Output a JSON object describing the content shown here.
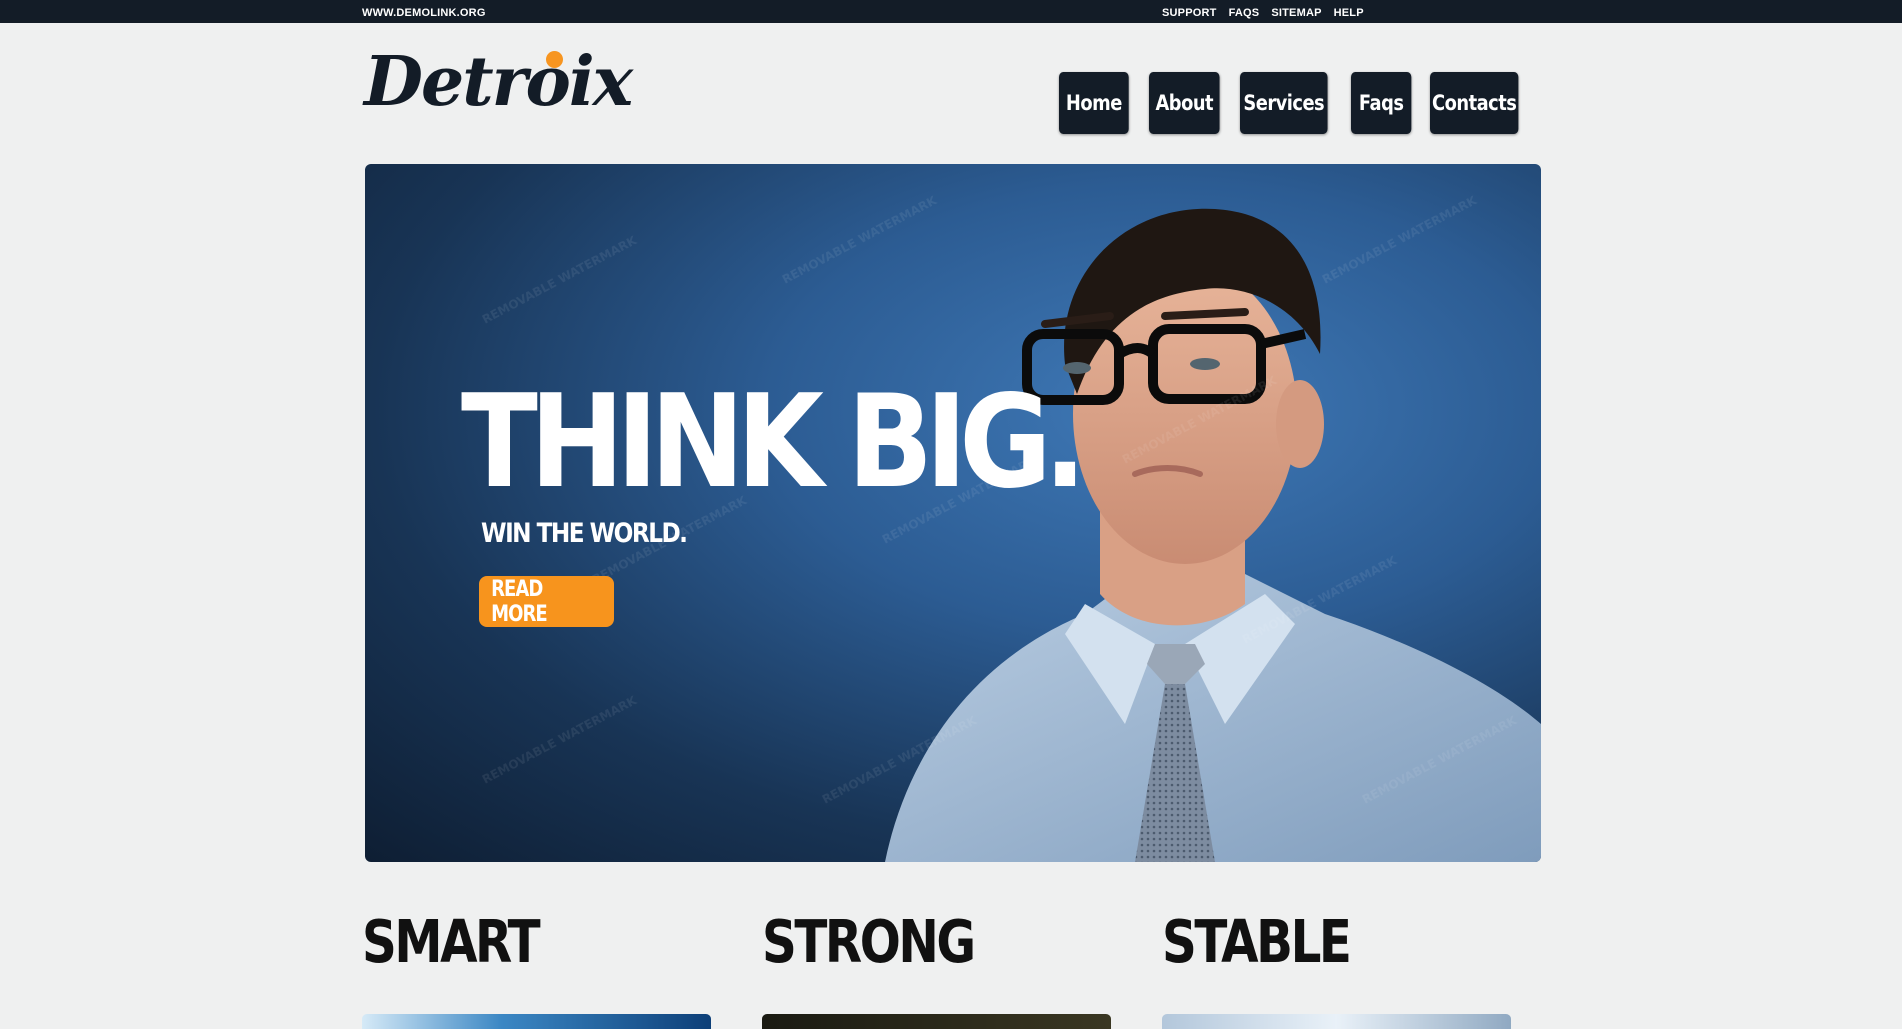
{
  "topbar": {
    "site_url": "WWW.DEMOLINK.ORG",
    "links": [
      "SUPPORT",
      "FAQS",
      "SITEMAP",
      "HELP"
    ]
  },
  "logo": {
    "text": "Detroix"
  },
  "nav": {
    "items": [
      "Home",
      "About",
      "Services",
      "Faqs",
      "Contacts"
    ]
  },
  "hero": {
    "title": "THINK BIG.",
    "subtitle": "WIN THE WORLD.",
    "button": "READ MORE",
    "watermark": "REMOVABLE WATERMARK"
  },
  "features": [
    {
      "title": "SMART"
    },
    {
      "title": "STRONG"
    },
    {
      "title": "STABLE"
    }
  ],
  "colors": {
    "dark_navy": "#131c27",
    "accent_orange": "#f7941d",
    "background": "#eff0f0",
    "hero_blue": "#2c5c93"
  }
}
